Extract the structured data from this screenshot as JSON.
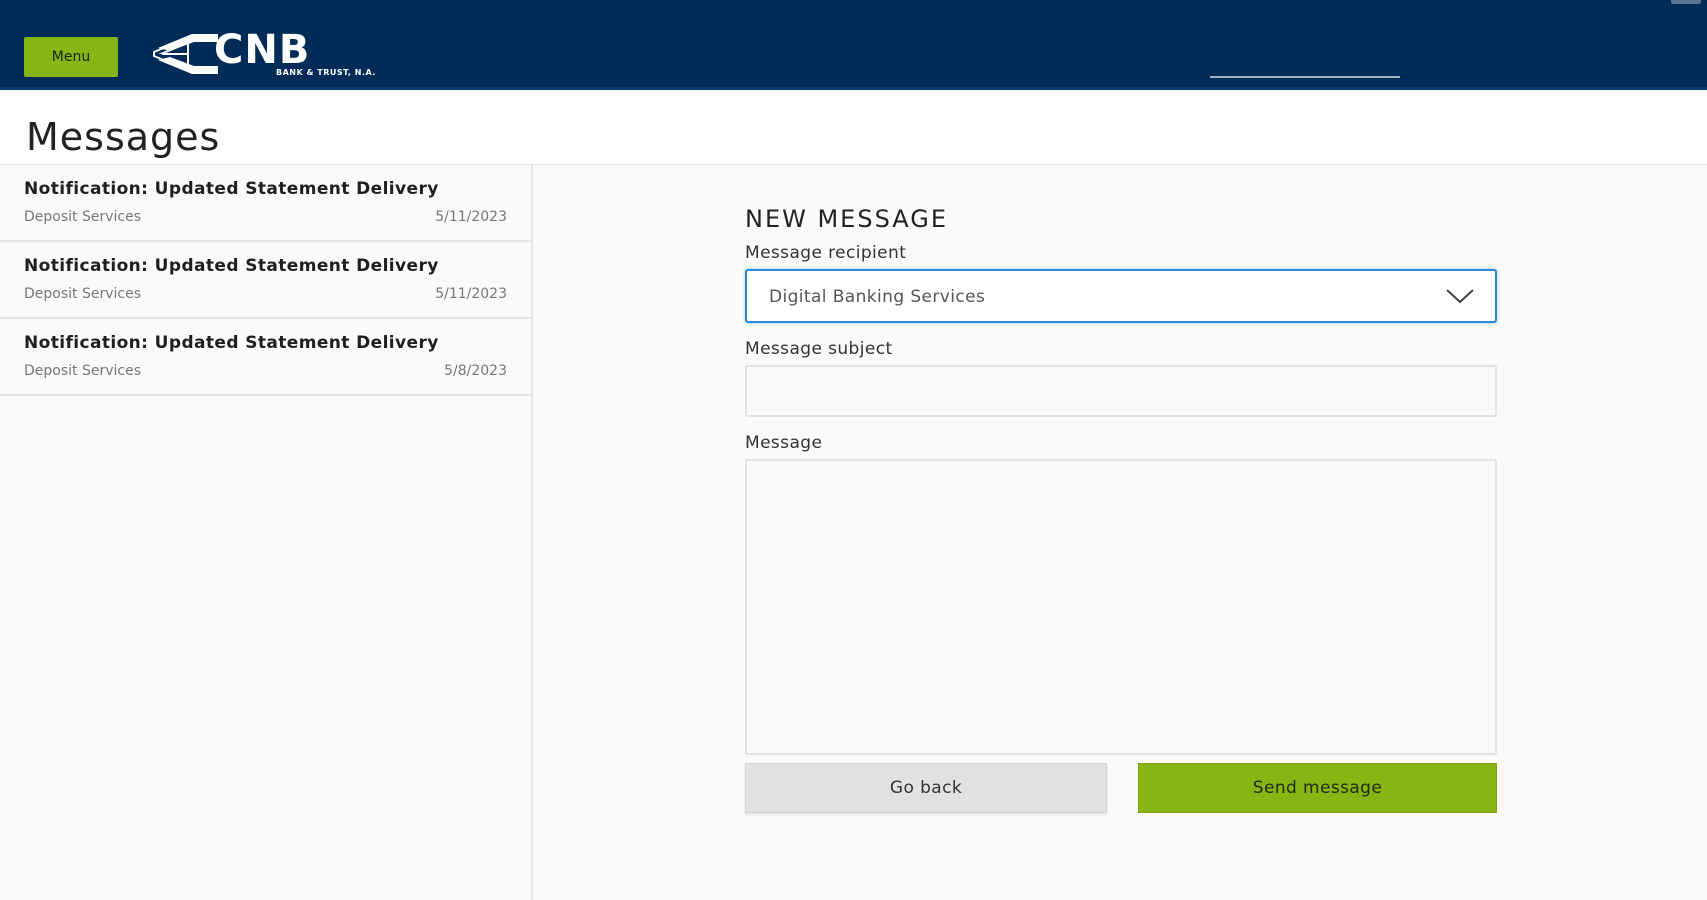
{
  "header": {
    "menu_label": "Menu",
    "logo_text": "CNB",
    "logo_subtext": "BANK & TRUST, N.A.",
    "brand_color": "#002c57",
    "accent_color": "#86b514"
  },
  "page": {
    "title": "Messages"
  },
  "sidebar": {
    "messages": [
      {
        "subject": "Notification: Updated Statement Delivery",
        "sender": "Deposit Services",
        "date": "5/11/2023"
      },
      {
        "subject": "Notification: Updated Statement Delivery",
        "sender": "Deposit Services",
        "date": "5/11/2023"
      },
      {
        "subject": "Notification: Updated Statement Delivery",
        "sender": "Deposit Services",
        "date": "5/8/2023"
      }
    ]
  },
  "form": {
    "heading": "NEW MESSAGE",
    "recipient_label": "Message recipient",
    "recipient_value": "Digital Banking Services",
    "subject_label": "Message subject",
    "subject_value": "",
    "message_label": "Message",
    "message_value": "",
    "back_label": "Go back",
    "send_label": "Send message"
  },
  "icons": {
    "dropdown": "chevron-down-icon",
    "logo": "cnb-logo-icon"
  }
}
